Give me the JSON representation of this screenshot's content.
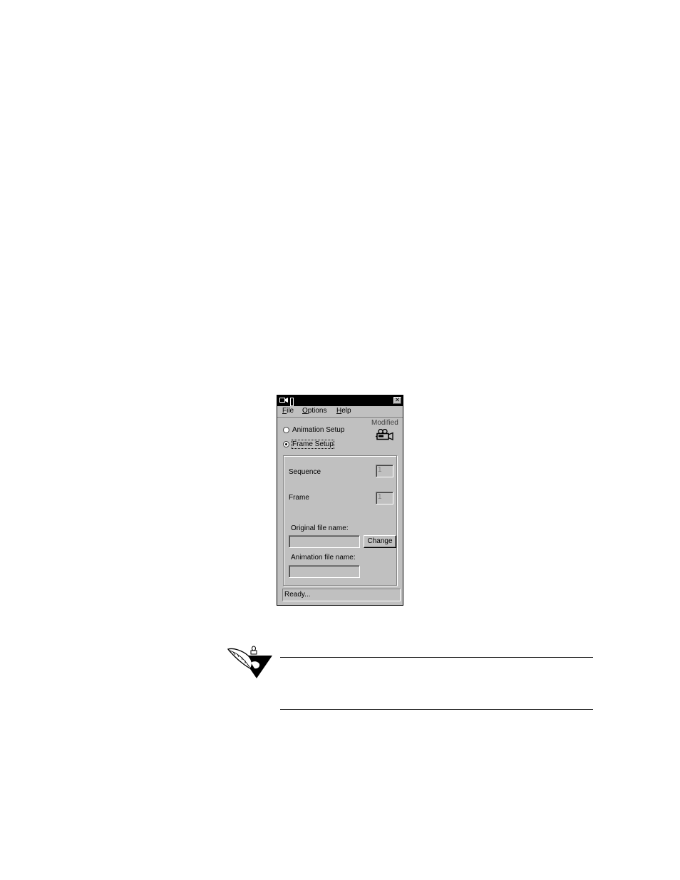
{
  "window": {
    "menu": {
      "file": {
        "accel": "F",
        "rest": "ile"
      },
      "options": {
        "accel": "O",
        "rest": "ptions"
      },
      "help": {
        "accel": "H",
        "rest": "elp"
      }
    },
    "modified_label": "Modified",
    "radio_animation_setup": "Animation Setup",
    "radio_frame_setup": "Frame Setup",
    "selected_mode": "Frame Setup",
    "sequence_label": "Sequence",
    "sequence_value": "1",
    "frame_label": "Frame",
    "frame_value": "1",
    "original_file_label": "Original file name:",
    "original_file_value": "",
    "change_button": "Change",
    "animation_file_label": "Animation file name:",
    "animation_file_value": "",
    "status_text": "Ready..."
  },
  "icons": {
    "app": "app-icon",
    "close": "close-icon",
    "camera": "video-camera-icon",
    "note": "quill-note-icon"
  },
  "colors": {
    "window_face": "#c0c0c0",
    "titlebar": "#000000"
  }
}
